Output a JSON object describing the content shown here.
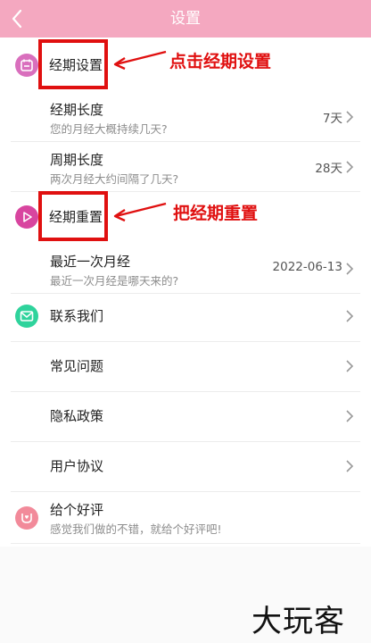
{
  "header": {
    "title": "设置",
    "back_icon": "chevron-left-icon"
  },
  "sections": {
    "period_settings": {
      "label": "经期设置",
      "icon": "calendar-icon",
      "color": "#d96fbd"
    },
    "period_reset": {
      "label": "经期重置",
      "icon": "play-icon",
      "color": "#d8459f"
    }
  },
  "rows": {
    "period_length": {
      "title": "经期长度",
      "subtitle": "您的月经大概持续几天?",
      "value": "7天"
    },
    "cycle_length": {
      "title": "周期长度",
      "subtitle": "两次月经大约间隔了几天?",
      "value": "28天"
    },
    "last_period": {
      "title": "最近一次月经",
      "subtitle": "最近一次月经是哪天来的?",
      "value": "2022-06-13"
    }
  },
  "links": {
    "contact_us": {
      "label": "联系我们",
      "icon": "mail-icon",
      "color": "#2fd39c"
    },
    "faq": {
      "label": "常见问题"
    },
    "privacy": {
      "label": "隐私政策"
    },
    "user_agreement": {
      "label": "用户协议"
    }
  },
  "rating": {
    "title": "给个好评",
    "subtitle": "感觉我们做的不错，就给个好评吧!",
    "icon": "heart-badge-icon",
    "color": "#f28a9a"
  },
  "annotations": {
    "click_period_settings": "点击经期设置",
    "reset_period": "把经期重置"
  },
  "watermark": "大玩客",
  "colors": {
    "header": "#f4a8c0",
    "annotation_red": "#e01010"
  }
}
